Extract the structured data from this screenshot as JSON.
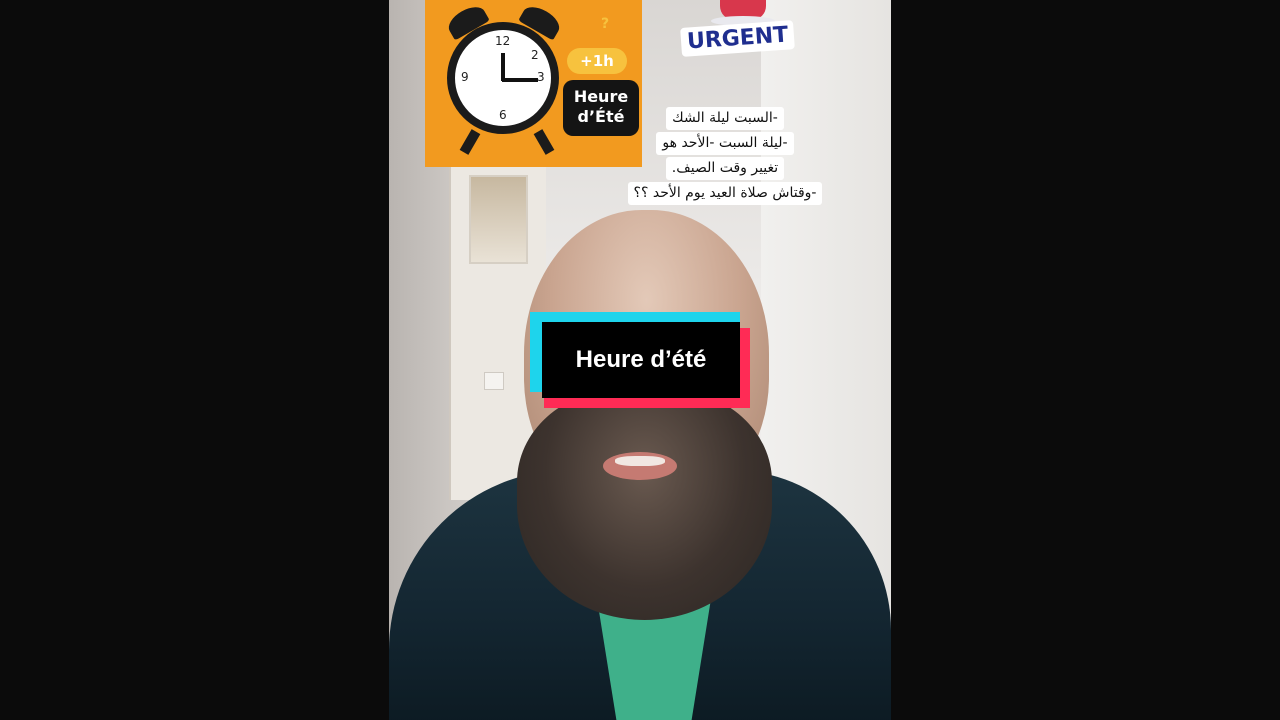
{
  "overlay": {
    "title": "Heure d’été",
    "sticker_urgent": "URGENT",
    "clock_sticker": {
      "plus": "+1h",
      "badge_line1": "Heure",
      "badge_line2": "d’Été",
      "question": "?",
      "numbers": {
        "n12": "12",
        "n3": "3",
        "n6": "6",
        "n9": "9",
        "n2": "2"
      }
    },
    "caption_lines": [
      "-السبت ليلة الشك",
      "-ليلة السبت -الأحد هو",
      "تغيير وقت الصيف.",
      "-وقتاش صلاة العيد يوم الأحد ؟؟"
    ]
  },
  "colors": {
    "page_bg": "#0b0b0b",
    "clock_orange": "#f29a1f",
    "accent_cyan": "#1ed4ec",
    "accent_red": "#ff2b55",
    "urgent_blue": "#1f2e8f"
  }
}
